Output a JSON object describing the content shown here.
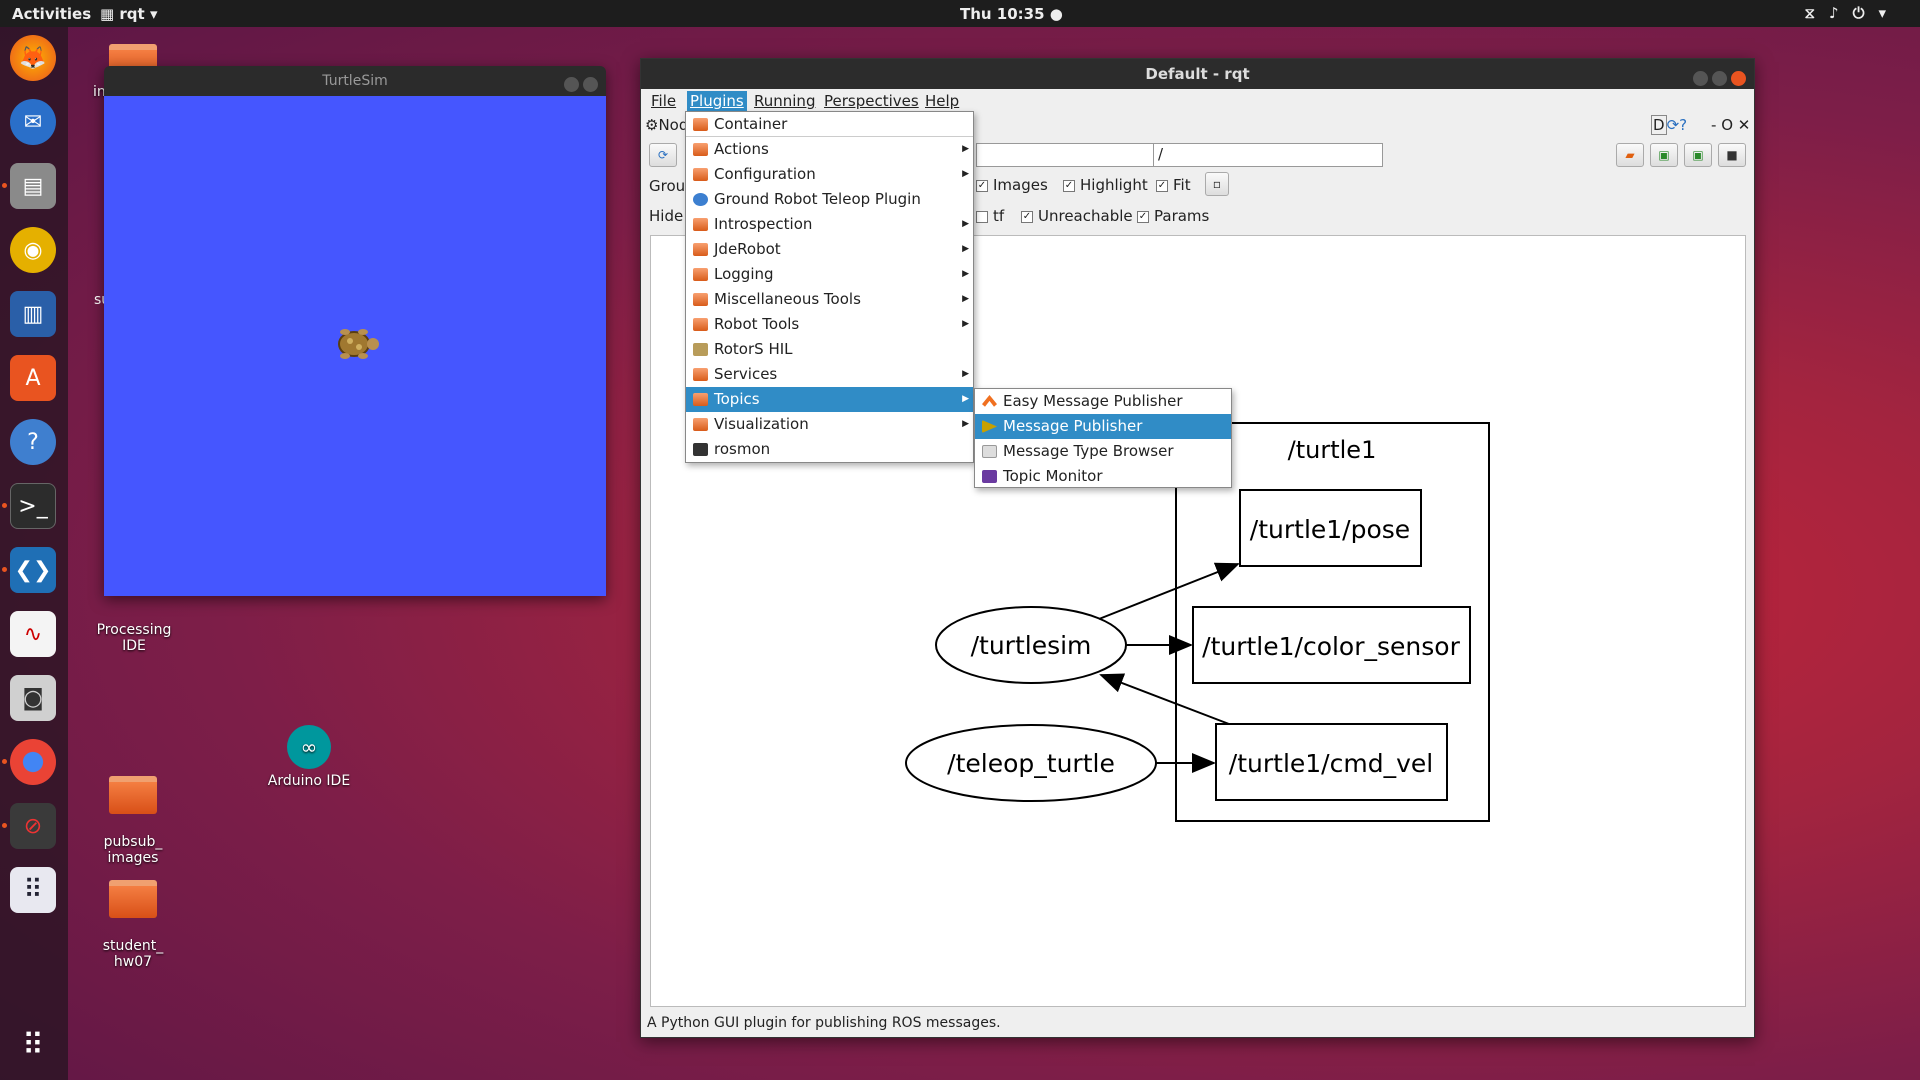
{
  "topbar": {
    "activities": "Activities",
    "app_menu": "rqt",
    "clock": "Thu 10:35"
  },
  "desktop": {
    "icons": [
      {
        "label": "Processing\nIDE"
      },
      {
        "label": "Arduino IDE"
      },
      {
        "label": "pubsub_\nimages"
      },
      {
        "label": "student_\nhw07"
      }
    ],
    "partial_labels": [
      "in",
      "su"
    ]
  },
  "turtlesim": {
    "title": "TurtleSim",
    "background_color": "#4556ff"
  },
  "rqt": {
    "title": "Default - rqt",
    "menubar": [
      "File",
      "Plugins",
      "Running",
      "Perspectives",
      "Help"
    ],
    "plugin_tab_partial": "Nod",
    "plugin_tab_controls": "D",
    "topic_filter_value": "/",
    "group_label_partial": "Grou",
    "hide_label": "Hide:",
    "options_row1": [
      {
        "label": "Images",
        "checked": true
      },
      {
        "label": "Highlight",
        "checked": true
      },
      {
        "label": "Fit",
        "checked": true
      }
    ],
    "options_row2": [
      {
        "label": "tf",
        "checked": false
      },
      {
        "label": "Unreachable",
        "checked": true
      },
      {
        "label": "Params",
        "checked": true
      }
    ],
    "status": "A Python GUI plugin for publishing ROS messages."
  },
  "plugins_menu": {
    "items": [
      {
        "label": "Container",
        "icon": "folder-icon",
        "submenu": false
      },
      {
        "label": "Actions",
        "icon": "folder-icon",
        "submenu": true
      },
      {
        "label": "Configuration",
        "icon": "folder-icon",
        "submenu": true
      },
      {
        "label": "Ground Robot Teleop Plugin",
        "icon": "globe-icon",
        "submenu": false
      },
      {
        "label": "Introspection",
        "icon": "folder-icon",
        "submenu": true
      },
      {
        "label": "JdeRobot",
        "icon": "folder-icon",
        "submenu": true
      },
      {
        "label": "Logging",
        "icon": "folder-icon",
        "submenu": true
      },
      {
        "label": "Miscellaneous Tools",
        "icon": "folder-icon",
        "submenu": true
      },
      {
        "label": "Robot Tools",
        "icon": "folder-icon",
        "submenu": true
      },
      {
        "label": "RotorS HIL",
        "icon": "gear-icon",
        "submenu": false
      },
      {
        "label": "Services",
        "icon": "folder-icon",
        "submenu": true
      },
      {
        "label": "Topics",
        "icon": "folder-icon",
        "submenu": true,
        "highlighted": true
      },
      {
        "label": "Visualization",
        "icon": "folder-icon",
        "submenu": true
      },
      {
        "label": "rosmon",
        "icon": "terminal-icon",
        "submenu": false
      }
    ]
  },
  "topics_submenu": {
    "items": [
      {
        "label": "Easy Message Publisher",
        "icon": "arrow-up-icon"
      },
      {
        "label": "Message Publisher",
        "icon": "play-icon",
        "highlighted": true
      },
      {
        "label": "Message Type Browser",
        "icon": "document-icon"
      },
      {
        "label": "Topic Monitor",
        "icon": "monitor-icon"
      }
    ]
  },
  "graph": {
    "cluster_label": "/turtle1",
    "nodes": [
      "/turtlesim",
      "/teleop_turtle"
    ],
    "topics": [
      "/turtle1/pose",
      "/turtle1/color_sensor",
      "/turtle1/cmd_vel"
    ]
  }
}
